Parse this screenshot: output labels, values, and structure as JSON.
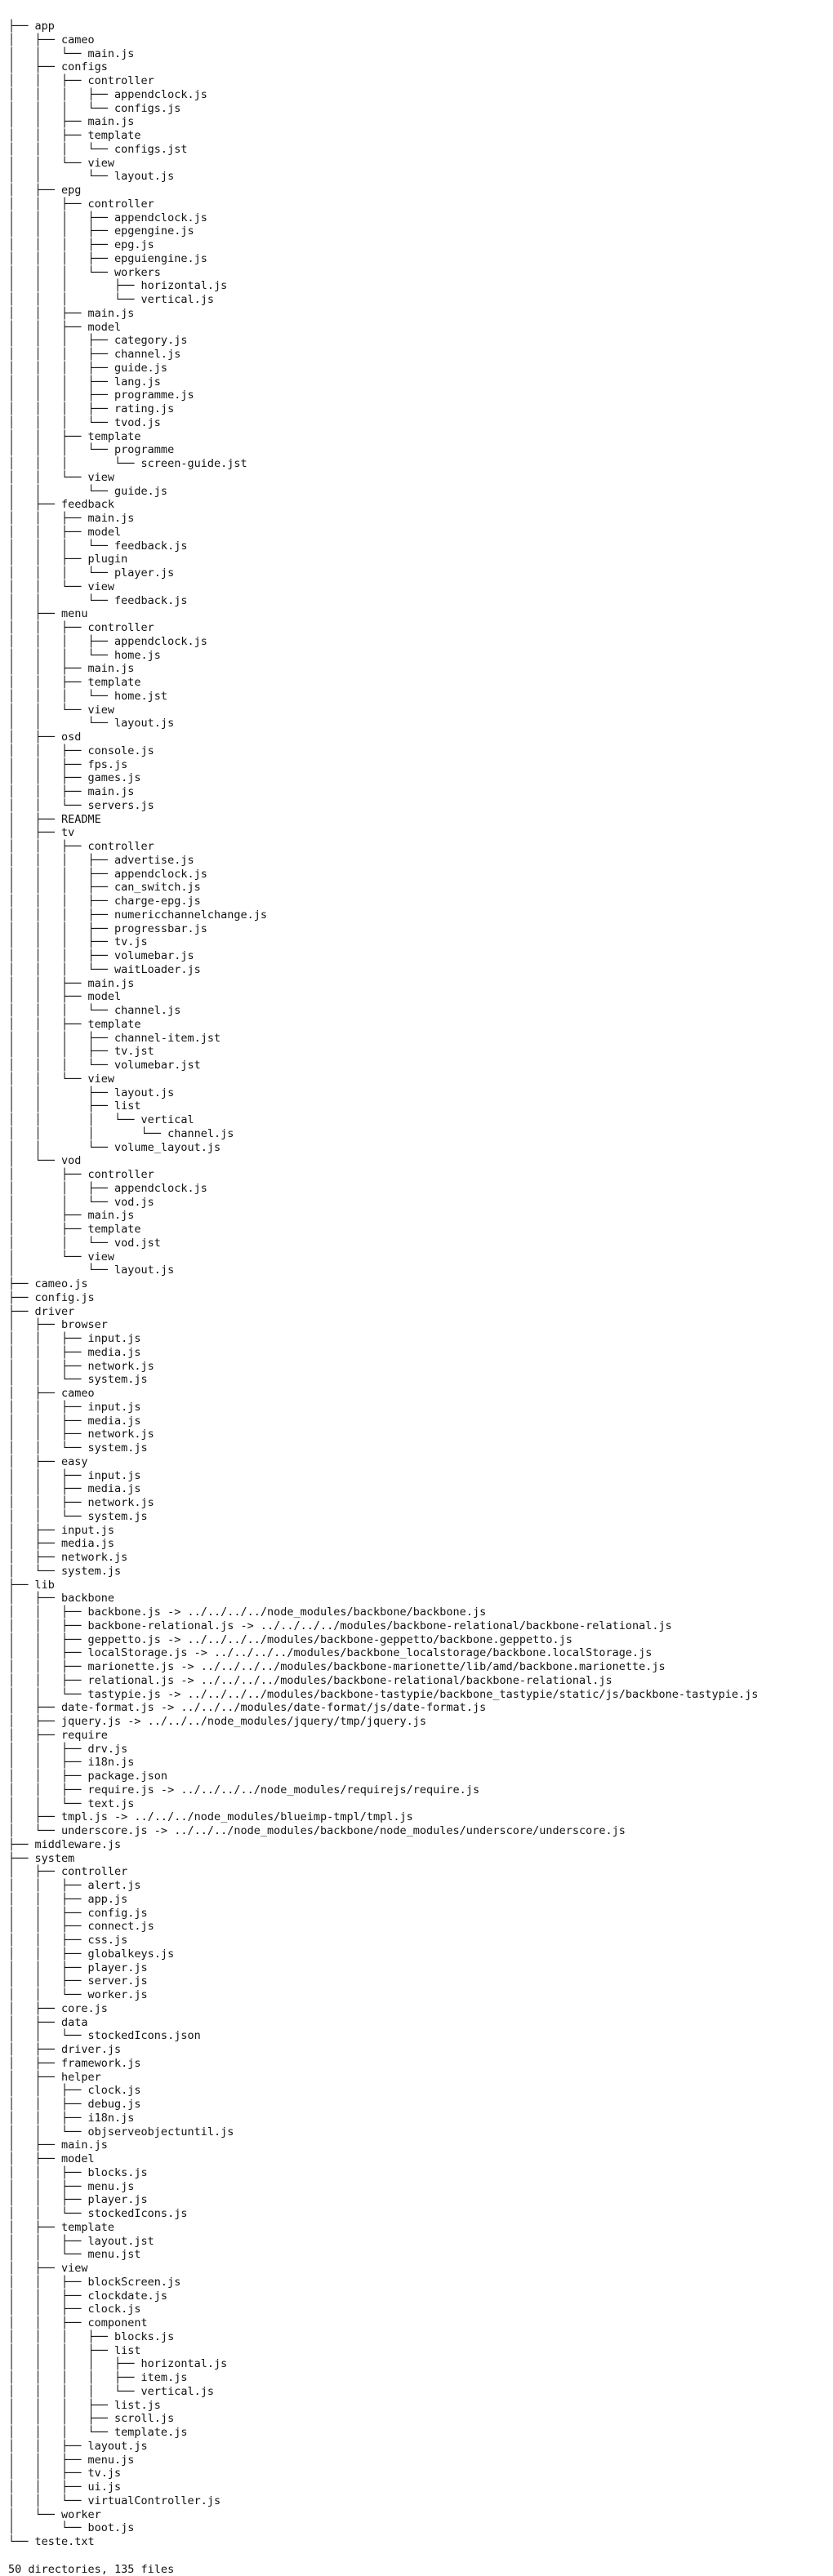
{
  "tree": {
    "lines": [
      "├── app",
      "│   ├── cameo",
      "│   │   └── main.js",
      "│   ├── configs",
      "│   │   ├── controller",
      "│   │   │   ├── appendclock.js",
      "│   │   │   └── configs.js",
      "│   │   ├── main.js",
      "│   │   ├── template",
      "│   │   │   └── configs.jst",
      "│   │   └── view",
      "│   │       └── layout.js",
      "│   ├── epg",
      "│   │   ├── controller",
      "│   │   │   ├── appendclock.js",
      "│   │   │   ├── epgengine.js",
      "│   │   │   ├── epg.js",
      "│   │   │   ├── epguiengine.js",
      "│   │   │   └── workers",
      "│   │   │       ├── horizontal.js",
      "│   │   │       └── vertical.js",
      "│   │   ├── main.js",
      "│   │   ├── model",
      "│   │   │   ├── category.js",
      "│   │   │   ├── channel.js",
      "│   │   │   ├── guide.js",
      "│   │   │   ├── lang.js",
      "│   │   │   ├── programme.js",
      "│   │   │   ├── rating.js",
      "│   │   │   └── tvod.js",
      "│   │   ├── template",
      "│   │   │   └── programme",
      "│   │   │       └── screen-guide.jst",
      "│   │   └── view",
      "│   │       └── guide.js",
      "│   ├── feedback",
      "│   │   ├── main.js",
      "│   │   ├── model",
      "│   │   │   └── feedback.js",
      "│   │   ├── plugin",
      "│   │   │   └── player.js",
      "│   │   └── view",
      "│   │       └── feedback.js",
      "│   ├── menu",
      "│   │   ├── controller",
      "│   │   │   ├── appendclock.js",
      "│   │   │   └── home.js",
      "│   │   ├── main.js",
      "│   │   ├── template",
      "│   │   │   └── home.jst",
      "│   │   └── view",
      "│   │       └── layout.js",
      "│   ├── osd",
      "│   │   ├── console.js",
      "│   │   ├── fps.js",
      "│   │   ├── games.js",
      "│   │   ├── main.js",
      "│   │   └── servers.js",
      "│   ├── README",
      "│   ├── tv",
      "│   │   ├── controller",
      "│   │   │   ├── advertise.js",
      "│   │   │   ├── appendclock.js",
      "│   │   │   ├── can_switch.js",
      "│   │   │   ├── charge-epg.js",
      "│   │   │   ├── numericchannelchange.js",
      "│   │   │   ├── progressbar.js",
      "│   │   │   ├── tv.js",
      "│   │   │   ├── volumebar.js",
      "│   │   │   └── waitLoader.js",
      "│   │   ├── main.js",
      "│   │   ├── model",
      "│   │   │   └── channel.js",
      "│   │   ├── template",
      "│   │   │   ├── channel-item.jst",
      "│   │   │   ├── tv.jst",
      "│   │   │   └── volumebar.jst",
      "│   │   └── view",
      "│   │       ├── layout.js",
      "│   │       ├── list",
      "│   │       │   └── vertical",
      "│   │       │       └── channel.js",
      "│   │       └── volume_layout.js",
      "│   └── vod",
      "│       ├── controller",
      "│       │   ├── appendclock.js",
      "│       │   └── vod.js",
      "│       ├── main.js",
      "│       ├── template",
      "│       │   └── vod.jst",
      "│       └── view",
      "│           └── layout.js",
      "├── cameo.js",
      "├── config.js",
      "├── driver",
      "│   ├── browser",
      "│   │   ├── input.js",
      "│   │   ├── media.js",
      "│   │   ├── network.js",
      "│   │   └── system.js",
      "│   ├── cameo",
      "│   │   ├── input.js",
      "│   │   ├── media.js",
      "│   │   ├── network.js",
      "│   │   └── system.js",
      "│   ├── easy",
      "│   │   ├── input.js",
      "│   │   ├── media.js",
      "│   │   ├── network.js",
      "│   │   └── system.js",
      "│   ├── input.js",
      "│   ├── media.js",
      "│   ├── network.js",
      "│   └── system.js",
      "├── lib",
      "│   ├── backbone",
      "│   │   ├── backbone.js -> ../../../../node_modules/backbone/backbone.js",
      "│   │   ├── backbone-relational.js -> ../../../../modules/backbone-relational/backbone-relational.js",
      "│   │   ├── geppetto.js -> ../../../../modules/backbone-geppetto/backbone.geppetto.js",
      "│   │   ├── localStorage.js -> ../../../../modules/backbone_localstorage/backbone.localStorage.js",
      "│   │   ├── marionette.js -> ../../../../modules/backbone-marionette/lib/amd/backbone.marionette.js",
      "│   │   ├── relational.js -> ../../../../modules/backbone-relational/backbone-relational.js",
      "│   │   └── tastypie.js -> ../../../../modules/backbone-tastypie/backbone_tastypie/static/js/backbone-tastypie.js",
      "│   ├── date-format.js -> ../../../modules/date-format/js/date-format.js",
      "│   ├── jquery.js -> ../../../node_modules/jquery/tmp/jquery.js",
      "│   ├── require",
      "│   │   ├── drv.js",
      "│   │   ├── i18n.js",
      "│   │   ├── package.json",
      "│   │   ├── require.js -> ../../../../node_modules/requirejs/require.js",
      "│   │   └── text.js",
      "│   ├── tmpl.js -> ../../../node_modules/blueimp-tmpl/tmpl.js",
      "│   └── underscore.js -> ../../../node_modules/backbone/node_modules/underscore/underscore.js",
      "├── middleware.js",
      "├── system",
      "│   ├── controller",
      "│   │   ├── alert.js",
      "│   │   ├── app.js",
      "│   │   ├── config.js",
      "│   │   ├── connect.js",
      "│   │   ├── css.js",
      "│   │   ├── globalkeys.js",
      "│   │   ├── player.js",
      "│   │   ├── server.js",
      "│   │   └── worker.js",
      "│   ├── core.js",
      "│   ├── data",
      "│   │   └── stockedIcons.json",
      "│   ├── driver.js",
      "│   ├── framework.js",
      "│   ├── helper",
      "│   │   ├── clock.js",
      "│   │   ├── debug.js",
      "│   │   ├── i18n.js",
      "│   │   └── objserveobjectuntil.js",
      "│   ├── main.js",
      "│   ├── model",
      "│   │   ├── blocks.js",
      "│   │   ├── menu.js",
      "│   │   ├── player.js",
      "│   │   └── stockedIcons.js",
      "│   ├── template",
      "│   │   ├── layout.jst",
      "│   │   └── menu.jst",
      "│   ├── view",
      "│   │   ├── blockScreen.js",
      "│   │   ├── clockdate.js",
      "│   │   ├── clock.js",
      "│   │   ├── component",
      "│   │   │   ├── blocks.js",
      "│   │   │   ├── list",
      "│   │   │   │   ├── horizontal.js",
      "│   │   │   │   ├── item.js",
      "│   │   │   │   └── vertical.js",
      "│   │   │   ├── list.js",
      "│   │   │   ├── scroll.js",
      "│   │   │   └── template.js",
      "│   │   ├── layout.js",
      "│   │   ├── menu.js",
      "│   │   ├── tv.js",
      "│   │   ├── ui.js",
      "│   │   └── virtualController.js",
      "│   └── worker",
      "│       └── boot.js",
      "└── teste.txt"
    ],
    "summary": "50 directories, 135 files"
  }
}
